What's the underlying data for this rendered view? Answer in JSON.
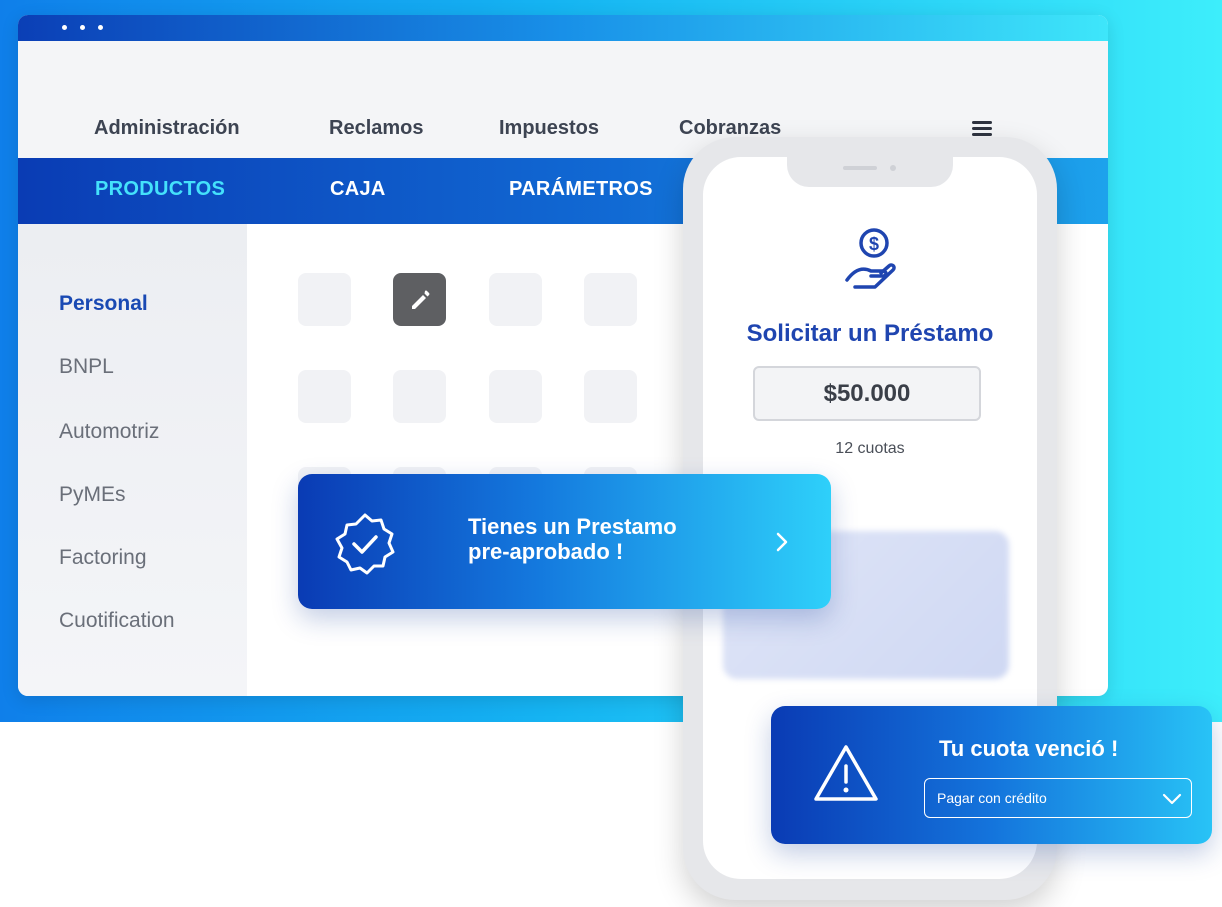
{
  "top_nav": {
    "items": [
      "Administración",
      "Reclamos",
      "Impuestos",
      "Cobranzas"
    ],
    "menu_icon": "hamburger-icon"
  },
  "sub_nav": {
    "items": [
      "PRODUCTOS",
      "CAJA",
      "PARÁMETROS"
    ],
    "active": "PRODUCTOS"
  },
  "sidebar": {
    "items": [
      "Personal",
      "BNPL",
      "Automotriz",
      "PyMEs",
      "Factoring",
      "Cuotification"
    ],
    "active": "Personal"
  },
  "grid": {
    "edit_icon": "pencil-icon"
  },
  "loan_banner": {
    "line1": "Tienes un Prestamo",
    "line2": "pre-aprobado !",
    "icon": "verified-badge-icon",
    "chevron": "chevron-right-icon"
  },
  "phone": {
    "icon": "hand-coin-icon",
    "title": "Solicitar un Préstamo",
    "amount": "$50.000",
    "installments": "12 cuotas"
  },
  "due_banner": {
    "title": "Tu cuota venció !",
    "select_value": "Pagar con crédito",
    "icon": "warning-icon"
  },
  "colors": {
    "brand_dark": "#0a3cb4",
    "brand_cyan": "#3deefb",
    "accent_active": "#44e1fb",
    "title_blue": "#1f45b0"
  }
}
